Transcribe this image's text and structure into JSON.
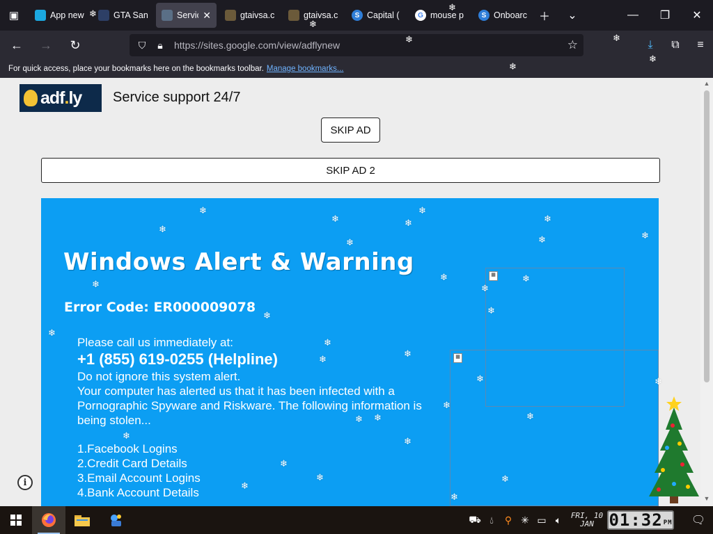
{
  "browser": {
    "tabs": [
      {
        "title": "App new",
        "color": "#1ba8e0",
        "glyph": ""
      },
      {
        "title": "GTA San",
        "color": "#2d3f66",
        "glyph": ""
      },
      {
        "title": "Servic",
        "color": "#5a6f86",
        "glyph": "",
        "active": true
      },
      {
        "title": "gtaivsa.c",
        "color": "#6b5a3a",
        "glyph": ""
      },
      {
        "title": "gtaivsa.c",
        "color": "#6b5a3a",
        "glyph": ""
      },
      {
        "title": "Capital (",
        "color": "#2f7ed8",
        "glyph": "S"
      },
      {
        "title": "mouse p",
        "color": "#ffffff",
        "glyph": "G"
      },
      {
        "title": "Onboarc",
        "color": "#2f7ed8",
        "glyph": "S"
      }
    ],
    "url": "https://sites.google.com/view/adflynew",
    "bookmarks_hint": "For quick access, place your bookmarks here on the bookmarks toolbar.",
    "bookmarks_link": "Manage bookmarks..."
  },
  "page": {
    "logo_text": "adf",
    "logo_dot": ".",
    "logo_tail": "ly",
    "service": "Service support 24/7",
    "skip1": "SKIP AD",
    "skip2": "SKIP AD 2",
    "alert": {
      "title": "Windows Alert & Warning",
      "code": "Error Code: ER000009078",
      "line1": "Please call us immediately at:",
      "phone": "+1 (855) 619-0255 (Helpline)",
      "line2": "Do not ignore this system alert.",
      "line3": "Your computer has alerted us that it has been infected with a Pornographic Spyware and Riskware. The following information is being stolen...",
      "items": [
        "1.Facebook Logins",
        "2.Credit Card Details",
        "3.Email Account Logins",
        "4.Bank Account Details"
      ]
    }
  },
  "taskbar": {
    "date_line1": "FRI, 10",
    "date_line2": "JAN",
    "clock": "01:32",
    "clock_suffix": "PM"
  }
}
